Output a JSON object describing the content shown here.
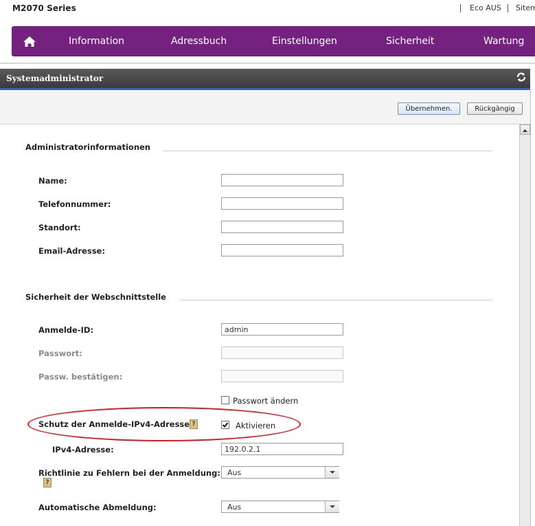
{
  "header": {
    "model": "M2070 Series",
    "links": [
      "Eco AUS",
      "Sitema"
    ]
  },
  "nav": {
    "home_icon": "house-icon",
    "items": [
      "Information",
      "Adressbuch",
      "Einstellungen",
      "Sicherheit",
      "Wartung"
    ],
    "color": "#74217f"
  },
  "panel": {
    "title": "Systemadministrator",
    "refresh_icon": "refresh-icon",
    "accent": "#3a5fc2"
  },
  "toolbar": {
    "apply_label": "Übernehmen.",
    "undo_label": "Rückgängig"
  },
  "admin_info": {
    "title": "Administratorinformationen",
    "fields": [
      {
        "label": "Name:",
        "value": ""
      },
      {
        "label": "Telefonnummer:",
        "value": ""
      },
      {
        "label": "Standort:",
        "value": ""
      },
      {
        "label": "Email-Adresse:",
        "value": ""
      }
    ]
  },
  "web_security": {
    "title": "Sicherheit der Webschnittstelle",
    "login_id": {
      "label": "Anmelde-ID:",
      "value": "admin"
    },
    "password": {
      "label": "Passwort:",
      "value": ""
    },
    "password_confirm": {
      "label": "Passw. bestätigen:",
      "value": ""
    },
    "change_password": {
      "label": "Passwort ändern",
      "checked": false
    },
    "ipv4_protection": {
      "label": "Schutz der Anmelde-IPv4-Adresse:",
      "enable_label": "Aktivieren",
      "checked": true,
      "help_icon": "help-icon"
    },
    "ipv4_address": {
      "label": "IPv4-Adresse:",
      "value": "192.0.2.1"
    },
    "login_failure_policy": {
      "label": "Richtlinie zu Fehlern bei der Anmeldung:",
      "value": "Aus",
      "help_icon": "help-icon"
    },
    "auto_logout": {
      "label": "Automatische Abmeldung:",
      "value": "Aus"
    }
  },
  "annotation": {
    "color": "#e0141e"
  }
}
